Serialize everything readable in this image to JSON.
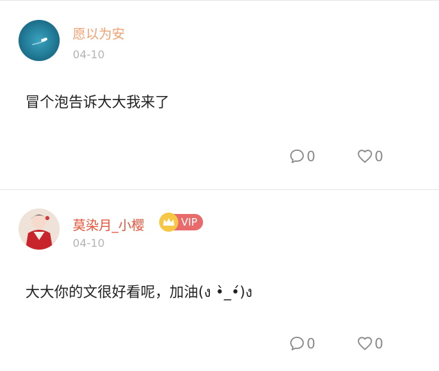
{
  "comments": [
    {
      "username": "愿以为安",
      "date": "04-10",
      "content": "冒个泡告诉大大我来了",
      "comment_count": "0",
      "like_count": "0"
    },
    {
      "username": "莫染月_小樱",
      "vip_label": "VIP",
      "date": "04-10",
      "content": "大大你的文很好看呢，加油(ง •̀_•́)ง",
      "comment_count": "0",
      "like_count": "0"
    }
  ],
  "icons": {
    "comment": "comment-bubble-icon",
    "like": "heart-icon",
    "vip": "crown-icon"
  },
  "colors": {
    "username_1": "#f0a172",
    "username_2": "#e6543a",
    "vip_badge": "#e96a6a",
    "vip_crown": "#f6c744",
    "date": "#b5b5b5",
    "divider": "#e6e6e6"
  }
}
